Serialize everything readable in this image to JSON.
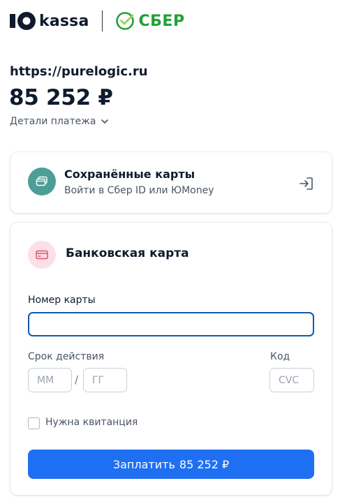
{
  "header": {
    "yookassa_name": "kassa",
    "sber_name": "СБЕР"
  },
  "payment": {
    "merchant": "https://purelogic.ru",
    "amount": "85 252 ₽",
    "details_label": "Детали платежа"
  },
  "saved_cards": {
    "title": "Сохранённые карты",
    "subtitle": "Войти в Сбер ID или ЮMoney"
  },
  "bank_card": {
    "title": "Банковская карта",
    "card_number_label": "Номер карты",
    "card_number_value": "",
    "expiry_label": "Срок действия",
    "month_placeholder": "ММ",
    "separator": "/",
    "year_placeholder": "ГГ",
    "cvc_label": "Код",
    "cvc_placeholder": "CVC",
    "receipt_label": "Нужна квитанция",
    "receipt_checked": false,
    "pay_label": "Заплатить",
    "pay_amount": "85 252 ₽"
  },
  "colors": {
    "brand_blue": "#1f6ff2",
    "sber_green": "#21a038",
    "focus_border": "#0f5aa8",
    "saved_icon_bg": "#4d9e96",
    "bank_icon_bg": "#fbe0e5"
  },
  "icons": {
    "yookassa": "yookassa-logo-icon",
    "sber": "sber-logo-icon",
    "details": "chevron-down-icon",
    "saved": "cards-stack-icon",
    "login": "login-arrow-icon",
    "bank": "credit-card-icon"
  }
}
